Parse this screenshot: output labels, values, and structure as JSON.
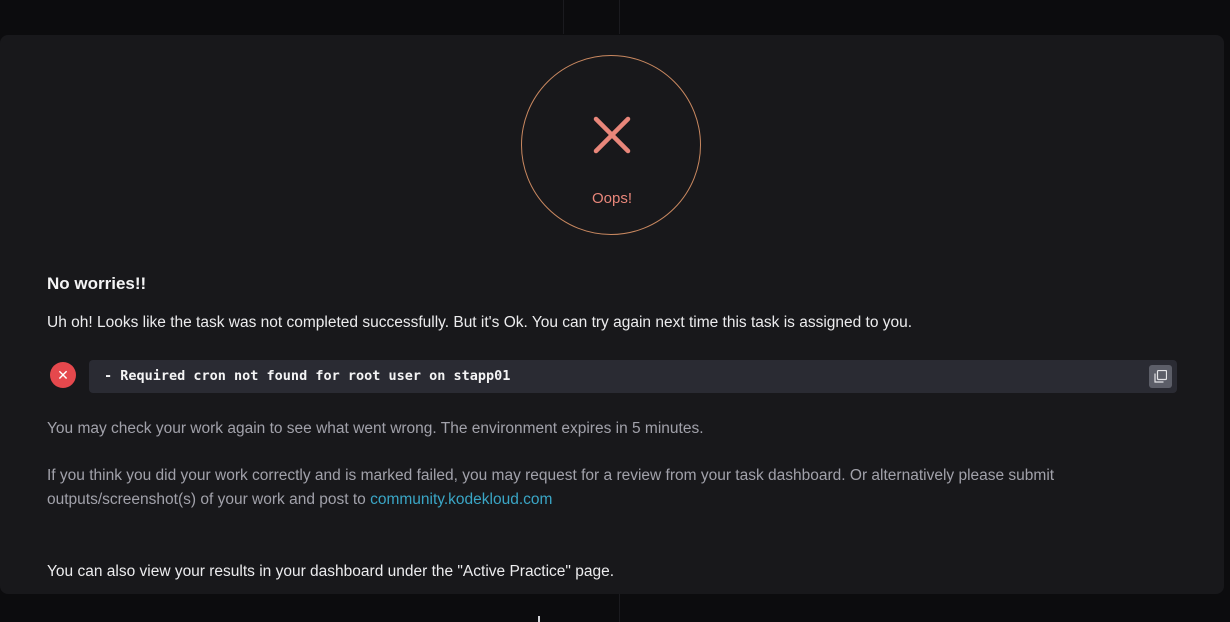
{
  "result_dialog": {
    "status_icon": "x-mark-icon",
    "status_label": "Oops!",
    "heading": "No worries!!",
    "intro": "Uh oh! Looks like the task was not completed successfully. But it's Ok. You can try again next time this task is assigned to you.",
    "error": {
      "icon": "error-x-icon",
      "message": "- Required cron not found for root user on stapp01",
      "copy_icon": "copy-icon"
    },
    "check_again": "You may check your work again to see what went wrong. The environment expires in 5 minutes.",
    "review_text": "If you think you did your work correctly and is marked failed, you may request for a review from your task dashboard. Or alternatively please submit outputs/screenshot(s) of your work and post to ",
    "community_link": "community.kodekloud.com",
    "dashboard_note": "You can also view your results in your dashboard under the \"Active Practice\" page."
  },
  "colors": {
    "dialog_bg": "#18181b",
    "error_red": "#e5484d",
    "oops_red": "#e8867a",
    "ring": "#c98860",
    "link": "#3aa6c6",
    "error_box_bg": "#2a2b33"
  }
}
